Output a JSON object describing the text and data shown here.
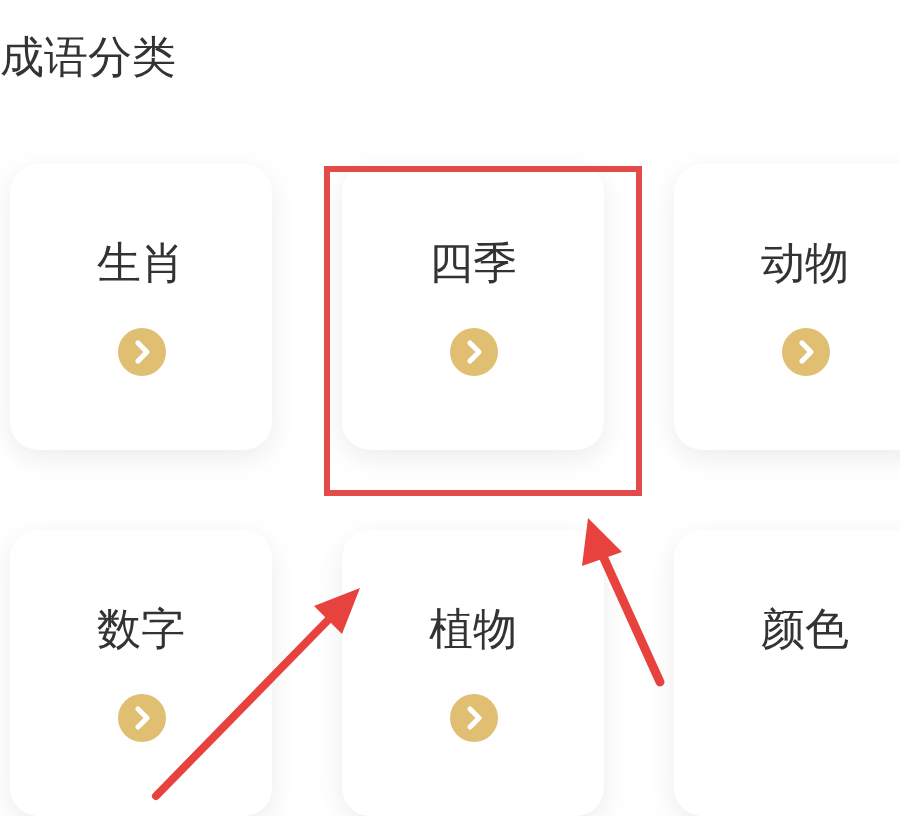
{
  "section_title": "成语分类",
  "categories": [
    {
      "label": "生肖",
      "highlighted": false,
      "has_arrow": true
    },
    {
      "label": "四季",
      "highlighted": true,
      "has_arrow": true
    },
    {
      "label": "动物",
      "highlighted": false,
      "has_arrow": true
    },
    {
      "label": "数字",
      "highlighted": false,
      "has_arrow": true
    },
    {
      "label": "植物",
      "highlighted": false,
      "has_arrow": true
    },
    {
      "label": "颜色",
      "highlighted": false,
      "has_arrow": false
    }
  ]
}
